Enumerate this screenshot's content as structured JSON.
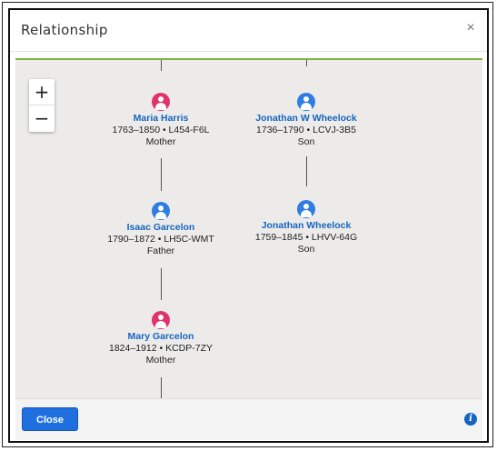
{
  "dialog": {
    "title": "Relationship",
    "close_icon": "×"
  },
  "zoom": {
    "in_label": "+",
    "out_label": "−"
  },
  "left_column": [
    {
      "name": "Maria Harris",
      "info": "1763–1850 • L454-F6L",
      "relation": "Mother",
      "gender": "female"
    },
    {
      "name": "Isaac Garcelon",
      "info": "1790–1872 • LH5C-WMT",
      "relation": "Father",
      "gender": "male"
    },
    {
      "name": "Mary Garcelon",
      "info": "1824–1912 • KCDP-7ZY",
      "relation": "Mother",
      "gender": "female"
    }
  ],
  "right_column": [
    {
      "name": "Jonathan W Wheelock",
      "info": "1736–1790 • LCVJ-3B5",
      "relation": "Son",
      "gender": "male"
    },
    {
      "name": "Jonathan Wheelock",
      "info": "1759–1845 • LHVV-64G",
      "relation": "Son",
      "gender": "male"
    }
  ],
  "footer": {
    "close_label": "Close",
    "info_icon": "i"
  },
  "colors": {
    "accent_green": "#7cb342",
    "female": "#e0336b",
    "male": "#2f7de1",
    "link_blue": "#1565c0",
    "button_blue": "#1f6fe0"
  }
}
